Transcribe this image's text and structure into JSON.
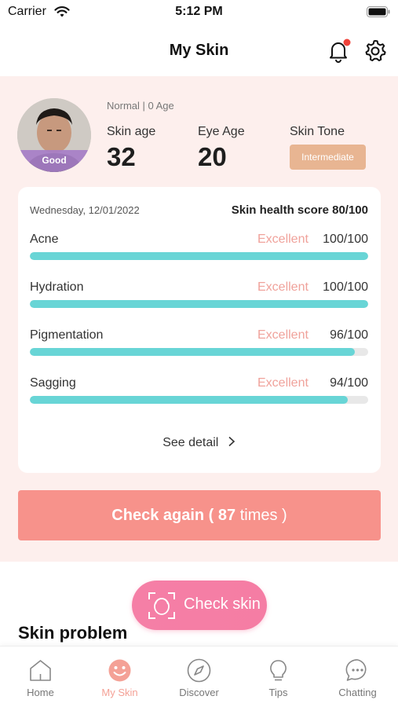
{
  "status_bar": {
    "carrier": "Carrier",
    "time": "5:12 PM"
  },
  "header": {
    "title": "My Skin"
  },
  "profile": {
    "subtitle": "Normal | 0 Age",
    "badge": "Good",
    "skin_age": {
      "label": "Skin age",
      "value": "32"
    },
    "eye_age": {
      "label": "Eye Age",
      "value": "20"
    },
    "skin_tone": {
      "label": "Skin Tone",
      "value": "Intermediate"
    }
  },
  "card": {
    "date": "Wednesday, 12/01/2022",
    "health_score": "Skin health score 80/100",
    "metrics": [
      {
        "name": "Acne",
        "rating": "Excellent",
        "score": "100/100",
        "fraction": 1.0
      },
      {
        "name": "Hydration",
        "rating": "Excellent",
        "score": "100/100",
        "fraction": 1.0
      },
      {
        "name": "Pigmentation",
        "rating": "Excellent",
        "score": "96/100",
        "fraction": 0.96
      },
      {
        "name": "Sagging",
        "rating": "Excellent",
        "score": "94/100",
        "fraction": 0.94
      }
    ],
    "see_detail": "See detail"
  },
  "check_again": {
    "label": "Check again (",
    "count": "87",
    "suffix": "times )"
  },
  "check_skin": {
    "label": "Check skin"
  },
  "section": {
    "title": "Skin problem"
  },
  "tabs": [
    {
      "label": "Home",
      "icon": "home-icon"
    },
    {
      "label": "My Skin",
      "icon": "smile-icon"
    },
    {
      "label": "Discover",
      "icon": "compass-icon"
    },
    {
      "label": "Tips",
      "icon": "lightbulb-icon"
    },
    {
      "label": "Chatting",
      "icon": "chat-icon"
    }
  ],
  "colors": {
    "accent_pink": "#f7928b",
    "bar_teal": "#68d5d6",
    "rating_pink": "#f0a29b",
    "tone_badge": "#e8b592",
    "active_tab": "#f4a196"
  }
}
